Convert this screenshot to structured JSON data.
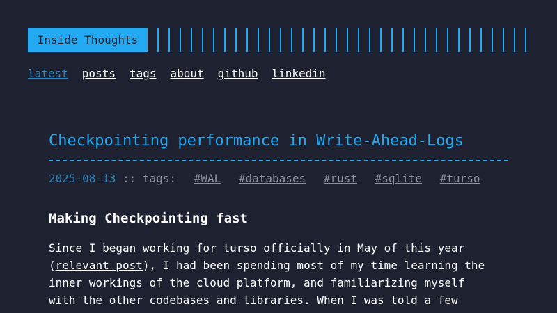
{
  "header": {
    "logo_text": "Inside Thoughts"
  },
  "nav": {
    "items": [
      {
        "label": "latest",
        "active": true
      },
      {
        "label": "posts"
      },
      {
        "label": "tags"
      },
      {
        "label": "about"
      },
      {
        "label": "github"
      },
      {
        "label": "linkedin"
      }
    ]
  },
  "post": {
    "title": "Checkpointing performance in Write-Ahead-Logs",
    "date": "2025-08-13",
    "tags_label": ":: tags:",
    "tags": [
      "#WAL",
      "#databases",
      "#rust",
      "#sqlite",
      "#turso"
    ],
    "section_heading": "Making Checkpointing fast",
    "body": {
      "line1": "Since I began working for turso officially in May of this year",
      "line2_open": "(",
      "line2_link": "relevant post",
      "line2_rest": "), I had been spending most of my time learning the",
      "line3": "inner workings of the cloud platform, and familiarizing myself",
      "line4": "with the other codebases and libraries. When I was told a few"
    }
  },
  "colors": {
    "background": "#1e2230",
    "accent": "#23a9f2",
    "active_link": "#2d86c1",
    "muted": "#8c929c",
    "text": "#ffffff"
  }
}
